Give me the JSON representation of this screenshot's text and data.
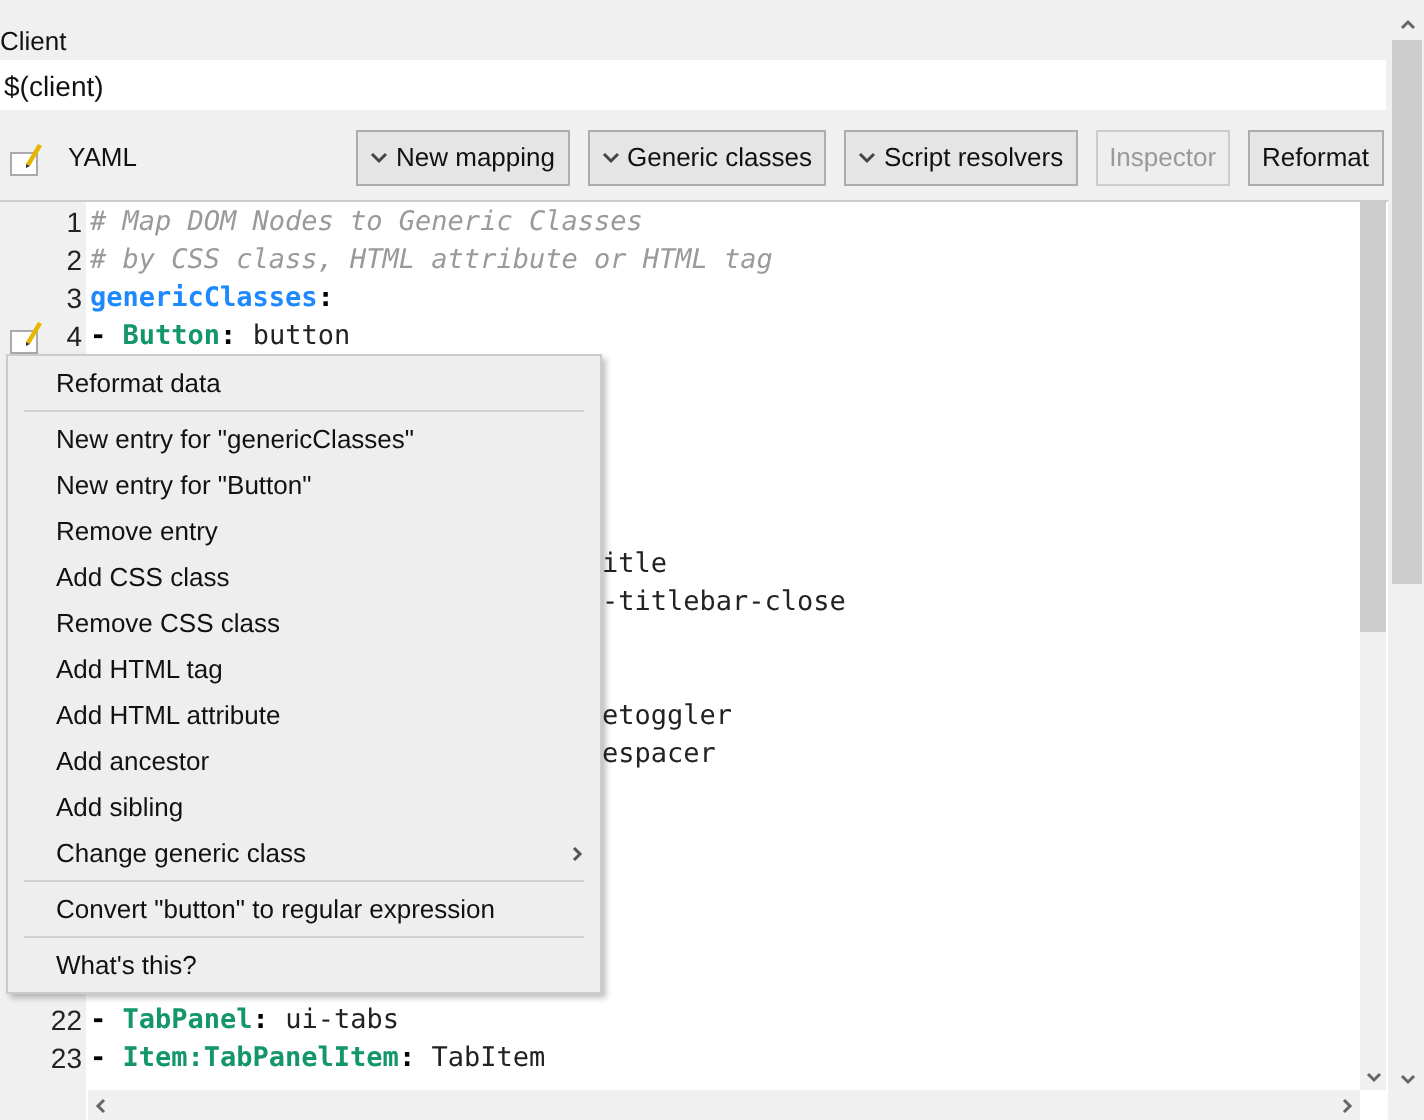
{
  "client": {
    "label": "Client",
    "value": "$(client)"
  },
  "toolbar": {
    "mode_label": "YAML",
    "buttons": [
      {
        "label": "New mapping",
        "kind": "dropdown",
        "disabled": false
      },
      {
        "label": "Generic classes",
        "kind": "dropdown",
        "disabled": false
      },
      {
        "label": "Script resolvers",
        "kind": "dropdown",
        "disabled": false
      },
      {
        "label": "Inspector",
        "kind": "plain",
        "disabled": true
      },
      {
        "label": "Reformat",
        "kind": "plain",
        "disabled": false
      }
    ]
  },
  "editor": {
    "lines_before": [
      {
        "number": "1",
        "bookmark": false,
        "tokens": [
          {
            "kind": "comment",
            "text": "# Map DOM Nodes to Generic Classes"
          }
        ]
      },
      {
        "number": "2",
        "bookmark": false,
        "tokens": [
          {
            "kind": "comment",
            "text": "# by CSS class, HTML attribute or HTML tag"
          }
        ]
      },
      {
        "number": "3",
        "bookmark": false,
        "tokens": [
          {
            "kind": "key",
            "text": "genericClasses"
          },
          {
            "kind": "punct",
            "text": ":"
          }
        ]
      },
      {
        "number": "4",
        "bookmark": true,
        "tokens": [
          {
            "kind": "punct",
            "text": "- "
          },
          {
            "kind": "type",
            "text": "Button"
          },
          {
            "kind": "punct",
            "text": ": "
          },
          {
            "kind": "value",
            "text": "button"
          }
        ]
      }
    ],
    "covered_fragments": [
      {
        "text": "itle"
      },
      {
        "text": "-titlebar-close"
      },
      {
        "text": "etoggler"
      },
      {
        "text": "espacer"
      }
    ],
    "lines_after": [
      {
        "number": "22",
        "bookmark": false,
        "tokens": [
          {
            "kind": "punct",
            "text": "- "
          },
          {
            "kind": "type",
            "text": "TabPanel"
          },
          {
            "kind": "punct",
            "text": ": "
          },
          {
            "kind": "value",
            "text": "ui-tabs"
          }
        ]
      },
      {
        "number": "23",
        "bookmark": false,
        "tokens": [
          {
            "kind": "punct",
            "text": "- "
          },
          {
            "kind": "type",
            "text": "Item:TabPanelItem"
          },
          {
            "kind": "punct",
            "text": ": "
          },
          {
            "kind": "value",
            "text": "TabItem"
          }
        ]
      }
    ]
  },
  "context_menu": {
    "items": [
      {
        "kind": "item",
        "label": "Reformat data"
      },
      {
        "kind": "separator"
      },
      {
        "kind": "item",
        "label": "New entry for \"genericClasses\""
      },
      {
        "kind": "item",
        "label": "New entry for \"Button\""
      },
      {
        "kind": "item",
        "label": "Remove entry"
      },
      {
        "kind": "item",
        "label": "Add CSS class"
      },
      {
        "kind": "item",
        "label": "Remove CSS class"
      },
      {
        "kind": "item",
        "label": "Add HTML tag"
      },
      {
        "kind": "item",
        "label": "Add HTML attribute"
      },
      {
        "kind": "item",
        "label": "Add ancestor"
      },
      {
        "kind": "item",
        "label": "Add sibling"
      },
      {
        "kind": "submenu",
        "label": "Change generic class"
      },
      {
        "kind": "separator"
      },
      {
        "kind": "item",
        "label": "Convert \"button\" to regular expression"
      },
      {
        "kind": "separator"
      },
      {
        "kind": "item",
        "label": "What's this?"
      }
    ]
  }
}
